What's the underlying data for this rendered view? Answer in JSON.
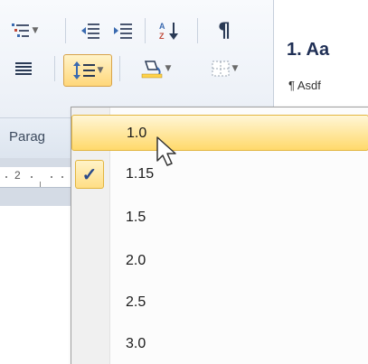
{
  "ribbon": {
    "group_label": "Parag",
    "row1_icons": [
      "multilevel-list-icon",
      "decrease-indent-icon",
      "increase-indent-icon",
      "sort-icon",
      "show-marks-icon"
    ],
    "row2_icons": [
      "justify-icon",
      "line-spacing-icon",
      "shading-icon",
      "borders-icon"
    ],
    "show_marks_glyph": "¶"
  },
  "ruler": {
    "number": "2"
  },
  "styles": {
    "heading_preview": "1. Aa",
    "normal_preview": "¶ Asdf"
  },
  "menu": {
    "items": [
      {
        "label": "1.0",
        "state": "hover",
        "checked": false
      },
      {
        "label": "1.15",
        "state": "normal",
        "checked": true
      },
      {
        "label": "1.5",
        "state": "normal",
        "checked": false
      },
      {
        "label": "2.0",
        "state": "normal",
        "checked": false
      },
      {
        "label": "2.5",
        "state": "normal",
        "checked": false
      },
      {
        "label": "3.0",
        "state": "normal",
        "checked": false
      }
    ],
    "check_glyph": "✓"
  },
  "colors": {
    "hover_fill": "#ffd96b",
    "hover_border": "#e2b53f",
    "check_color": "#2a4a8a",
    "heading_color": "#1f2f55"
  }
}
